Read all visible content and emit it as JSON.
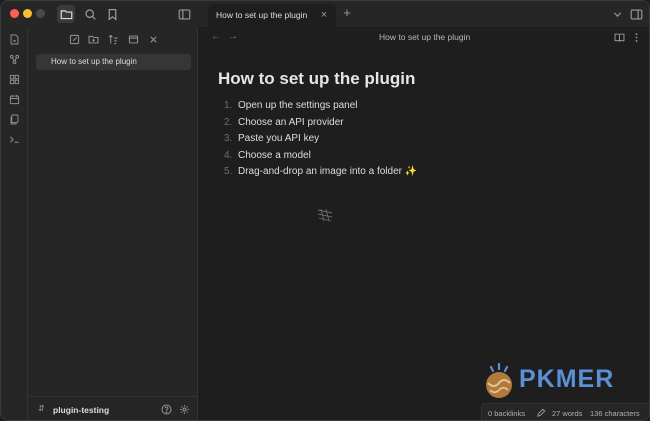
{
  "window": {
    "active_tab_title": "How to set up the plugin"
  },
  "titlebar": {
    "icons": [
      "folder-icon",
      "search-icon",
      "bookmark-icon",
      "sidebar-toggle-icon"
    ],
    "new_tab_glyph": "+",
    "tab_close_glyph": "×"
  },
  "ribbon": {
    "icons": [
      "open-quick-switcher-icon",
      "graph-view-icon",
      "canvas-icon",
      "daily-note-icon",
      "templates-icon",
      "command-palette-icon"
    ]
  },
  "sidebar": {
    "toolbar_icons": [
      "new-note-icon",
      "new-folder-icon",
      "sort-icon",
      "collapse-icon",
      "close-icon"
    ],
    "files": [
      {
        "label": "How to set up the plugin",
        "active": true
      }
    ],
    "vault_name": "plugin-testing"
  },
  "main": {
    "view_title": "How to set up the plugin",
    "note": {
      "title": "How to set up the plugin",
      "steps": [
        {
          "num": "1.",
          "text": "Open up the settings panel"
        },
        {
          "num": "2.",
          "text": "Choose an API provider"
        },
        {
          "num": "3.",
          "text": "Paste you API key"
        },
        {
          "num": "4.",
          "text": "Choose a model"
        },
        {
          "num": "5.",
          "text": "Drag-and-drop an image into a folder ✨"
        }
      ]
    }
  },
  "statusbar": {
    "backlinks": "0 backlinks",
    "words": "27 words",
    "characters": "136 characters"
  },
  "watermark": {
    "text": "PKMER"
  },
  "colors": {
    "background": "#1e1e1e",
    "panel": "#262626",
    "accent": "#5b8fd6"
  }
}
